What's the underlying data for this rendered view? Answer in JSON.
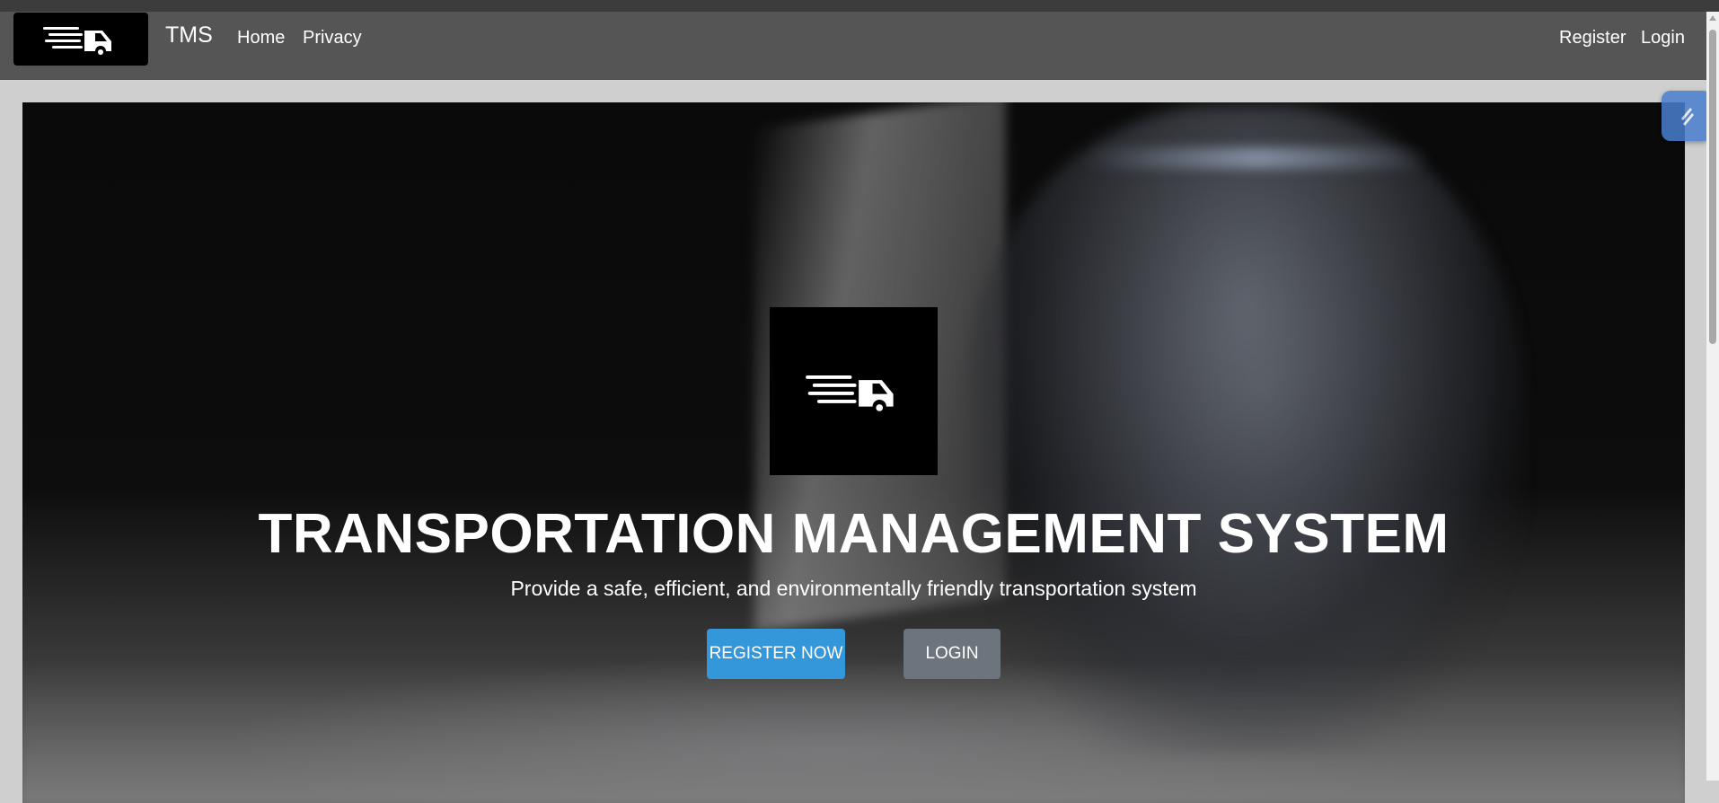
{
  "nav": {
    "brand": "TMS",
    "links": [
      "Home",
      "Privacy"
    ],
    "auth": {
      "register": "Register",
      "login": "Login"
    },
    "logo_icon": "fast-truck-icon"
  },
  "hero": {
    "logo_icon": "fast-truck-icon",
    "title": "TRANSPORTATION MANAGEMENT SYSTEM",
    "subtitle": "Provide a safe, efficient, and environmentally friendly transportation system",
    "register_button": "REGISTER NOW",
    "login_button": "LOGIN"
  },
  "extension_widget": {
    "icon": "extension-lightning-icon"
  },
  "colors": {
    "navbar_bg": "#555555",
    "primary_button": "#3497da",
    "secondary_button": "#6c757d",
    "logo_bg": "#000000"
  }
}
